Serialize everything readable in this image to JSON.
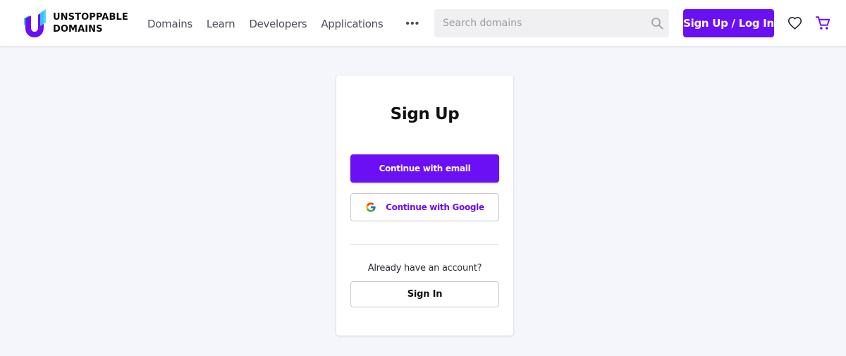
{
  "header": {
    "brand": {
      "line1": "UNSTOPPABLE",
      "line2": "DOMAINS"
    },
    "nav": [
      {
        "label": "Domains"
      },
      {
        "label": "Learn"
      },
      {
        "label": "Developers"
      },
      {
        "label": "Applications"
      }
    ],
    "more_label": "•••",
    "search": {
      "placeholder": "Search domains",
      "value": "",
      "icon": "search-icon"
    },
    "signup_login_label": "Sign Up / Log In",
    "icons": {
      "favorites": "heart-icon",
      "cart": "cart-icon"
    }
  },
  "card": {
    "title": "Sign Up",
    "email_button_label": "Continue with email",
    "google_button_label": "Continue with Google",
    "account_prompt": "Already have an account?",
    "signin_button_label": "Sign In"
  },
  "colors": {
    "accent": "#6b0ff5",
    "page_background": "#f5f6fb",
    "card_background": "#ffffff"
  }
}
